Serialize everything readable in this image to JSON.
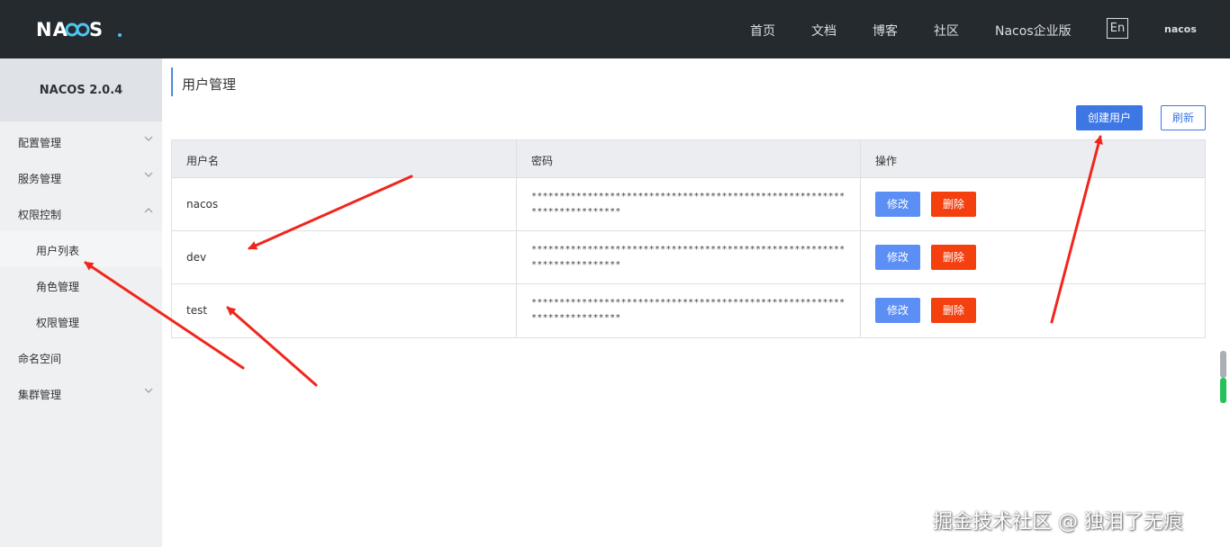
{
  "header": {
    "logo_text": "NACOS.",
    "nav": [
      "首页",
      "文档",
      "博客",
      "社区",
      "Nacos企业版"
    ],
    "lang_label": "En",
    "user": "nacos"
  },
  "sidebar": {
    "version": "NACOS 2.0.4",
    "items": [
      {
        "label": "配置管理",
        "chevron": "chevron-down-icon"
      },
      {
        "label": "服务管理",
        "chevron": "chevron-down-icon"
      },
      {
        "label": "权限控制",
        "chevron": "chevron-up-icon"
      },
      {
        "label": "用户列表"
      },
      {
        "label": "角色管理"
      },
      {
        "label": "权限管理"
      },
      {
        "label": "命名空间"
      },
      {
        "label": "集群管理",
        "chevron": "chevron-down-icon"
      }
    ]
  },
  "main": {
    "title": "用户管理",
    "create_label": "创建用户",
    "refresh_label": "刷新",
    "columns": [
      "用户名",
      "密码",
      "操作"
    ],
    "rows": [
      {
        "username": "nacos",
        "password": "************************************************************************",
        "edit": "修改",
        "delete": "删除"
      },
      {
        "username": "dev",
        "password": "************************************************************************",
        "edit": "修改",
        "delete": "删除"
      },
      {
        "username": "test",
        "password": "************************************************************************",
        "edit": "修改",
        "delete": "删除"
      }
    ]
  },
  "watermark": "掘金技术社区 @ 独泪了无痕",
  "colors": {
    "header_bg": "#252a2f",
    "primary": "#3c77e4",
    "edit": "#5b8ff5",
    "delete": "#f43f0f",
    "annotation_arrow": "#f0261d"
  }
}
